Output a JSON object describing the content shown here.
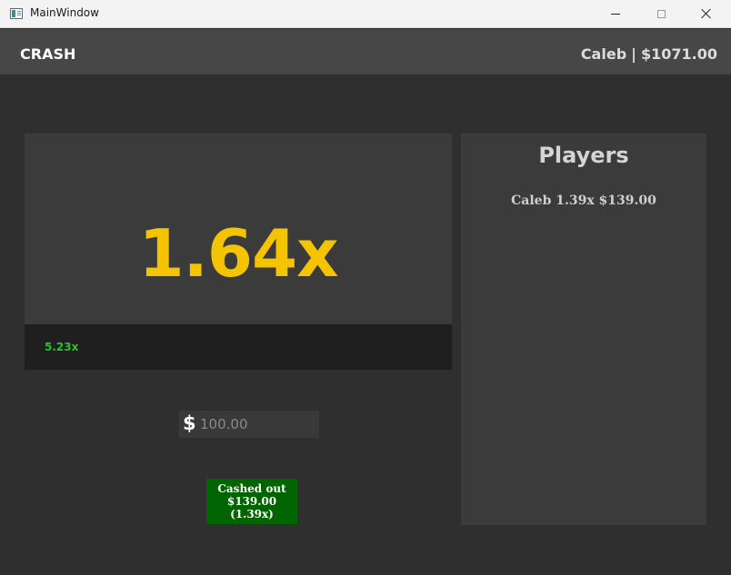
{
  "window": {
    "title": "MainWindow"
  },
  "header": {
    "app_name": "CRASH",
    "username": "Caleb",
    "separator": "|",
    "balance": "$1071.00"
  },
  "game": {
    "multiplier": "1.64x",
    "history": [
      "5.23x"
    ]
  },
  "bet": {
    "currency_symbol": "$",
    "placeholder": "100.00"
  },
  "cashout": {
    "line1": "Cashed out",
    "line2": "$139.00",
    "line3": "(1.39x)"
  },
  "players": {
    "title": "Players",
    "entries": [
      {
        "text": "Caleb 1.39x $139.00"
      }
    ]
  },
  "colors": {
    "multiplier": "#f5c400",
    "history_text": "#2ec12e",
    "cashout_button": "#006400",
    "background": "#2f2f2f",
    "panel": "#3b3b3b",
    "header": "#474747"
  }
}
